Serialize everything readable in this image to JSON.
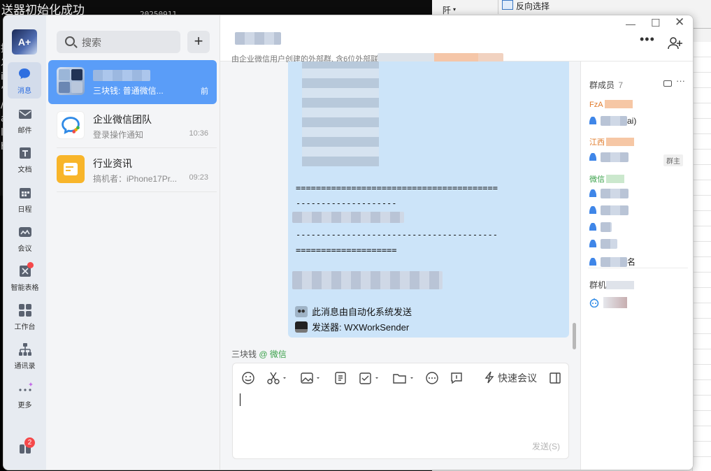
{
  "background": {
    "terminal_line": "送器初始化成功",
    "terminal_partial": "20250911",
    "terminal_chars": [
      "提",
      "发",
      "i",
      "’",
      "/",
      "a",
      "lt",
      "h"
    ],
    "excel_group_label": "阡",
    "excel_reverse_select": "反向选择"
  },
  "nav": {
    "avatar_text": "A+",
    "items": [
      {
        "label": "消息",
        "icon": "chat-bubble-icon"
      },
      {
        "label": "邮件",
        "icon": "mail-icon"
      },
      {
        "label": "文档",
        "icon": "document-icon"
      },
      {
        "label": "日程",
        "icon": "calendar-icon"
      },
      {
        "label": "会议",
        "icon": "meeting-icon"
      },
      {
        "label": "智能表格",
        "icon": "smart-table-icon"
      },
      {
        "label": "工作台",
        "icon": "workbench-icon"
      },
      {
        "label": "通讯录",
        "icon": "contacts-icon"
      },
      {
        "label": "更多",
        "icon": "more-icon"
      }
    ],
    "bottom_badge": "2"
  },
  "search": {
    "placeholder": "搜索"
  },
  "conversations": [
    {
      "name": "",
      "sub": "三块钱: 普通微信...",
      "time": "前",
      "selected": true
    },
    {
      "name": "企业微信团队",
      "sub": "登录操作通知",
      "time": "10:36"
    },
    {
      "name": "行业资讯",
      "sub": "搞机者：iPhone17Pr...",
      "time": "09:23"
    }
  ],
  "chat": {
    "description": "由企业微信用户创建的外部群, 含6位外部联",
    "message": {
      "eq_line_1": "========================================",
      "eq_line_2": "--------------------",
      "eq_line_3": "----------------------------------------",
      "eq_line_4": "====================",
      "robot_line": "此消息由自动化系统发送",
      "sender_line": "发送器: WXWorkSender"
    },
    "reply_name": "三块钱",
    "reply_source": "@ 微信",
    "composer": {
      "quick_meeting": "快速会议",
      "send_label": "发送(S)"
    }
  },
  "members": {
    "header": "群成员",
    "count": "7",
    "groups": [
      {
        "label": "FzA",
        "color": "#e07a2a"
      },
      {
        "label": "江西",
        "color": "#e07a2a"
      },
      {
        "label": "微信",
        "color": "#3aa14a"
      }
    ],
    "rows": [
      "ai)",
      "",
      "",
      "",
      "",
      "",
      "名"
    ],
    "owner_badge": "群主",
    "bots_header": "群机"
  },
  "colors": {
    "accent": "#5a9df8",
    "bubble": "#cce4f9",
    "nav_bg": "#e7ebf1",
    "badge": "#f5484a",
    "wechat_green": "#3aa14a"
  }
}
